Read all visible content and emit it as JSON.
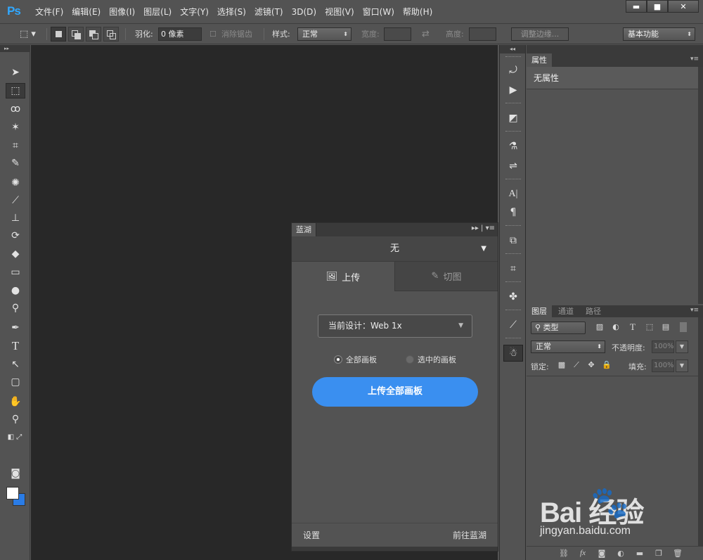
{
  "app": {
    "logo": "Ps"
  },
  "menu": [
    "文件(F)",
    "编辑(E)",
    "图像(I)",
    "图层(L)",
    "文字(Y)",
    "选择(S)",
    "滤镜(T)",
    "3D(D)",
    "视图(V)",
    "窗口(W)",
    "帮助(H)"
  ],
  "window_controls": {
    "minimize": "▬",
    "maximize": "■",
    "close": "✕"
  },
  "options": {
    "feather_label": "羽化:",
    "feather_value": "0 像素",
    "antialias_label": "消除锯齿",
    "style_label": "样式:",
    "style_value": "正常",
    "width_label": "宽度:",
    "height_label": "高度:",
    "refine_edge": "调整边缘...",
    "workspace": "基本功能"
  },
  "lanhu": {
    "tab": "蓝湖",
    "design_select": "无",
    "tab_upload": "上传",
    "tab_slice": "切图",
    "current_design": "当前设计：Web 1x",
    "radio_all": "全部画板",
    "radio_selected": "选中的画板",
    "upload_button": "上传全部画板",
    "settings": "设置",
    "goto": "前往蓝湖"
  },
  "properties": {
    "tab": "属性",
    "empty": "无属性"
  },
  "layers": {
    "tabs": [
      "图层",
      "通道",
      "路径"
    ],
    "filter": "类型",
    "blend_mode": "正常",
    "opacity_label": "不透明度:",
    "opacity_value": "100%",
    "lock_label": "锁定:",
    "fill_label": "填充:",
    "fill_value": "100%"
  },
  "watermark": {
    "main": "Bai  经验",
    "url": "jingyan.baidu.com"
  },
  "colors": {
    "accent": "#3a8ff0",
    "foreground": "#ffffff",
    "background": "#2a7ce6",
    "canvas": "#282828",
    "logo": "#31a8ff"
  }
}
